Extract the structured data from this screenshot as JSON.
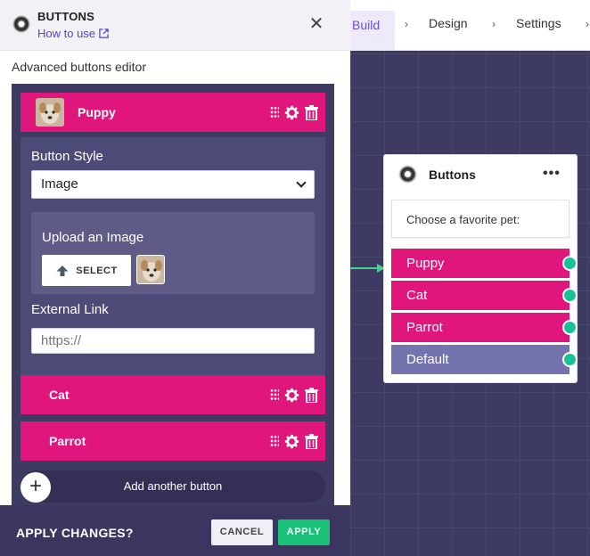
{
  "nav": {
    "build": "Build",
    "design": "Design",
    "settings": "Settings"
  },
  "header": {
    "title": "BUTTONS",
    "link": "How to use"
  },
  "editor": {
    "section_title": "Advanced buttons editor",
    "buttons": [
      {
        "label": "Puppy"
      },
      {
        "label": "Cat"
      },
      {
        "label": "Parrot"
      }
    ],
    "style_label": "Button Style",
    "style_value": "Image",
    "upload_label": "Upload an Image",
    "select_label": "SELECT",
    "link_label": "External Link",
    "link_placeholder": "https://",
    "add_label": "Add another button"
  },
  "footer": {
    "title": "APPLY CHANGES?",
    "cancel": "CANCEL",
    "apply": "APPLY"
  },
  "node": {
    "title": "Buttons",
    "prompt": "Choose a favorite pet:",
    "choices": [
      "Puppy",
      "Cat",
      "Parrot",
      "Default"
    ]
  },
  "colors": {
    "accent": "#e0167c",
    "green": "#19c178",
    "purple": "#3d3b61",
    "connector": "#19c19b"
  }
}
